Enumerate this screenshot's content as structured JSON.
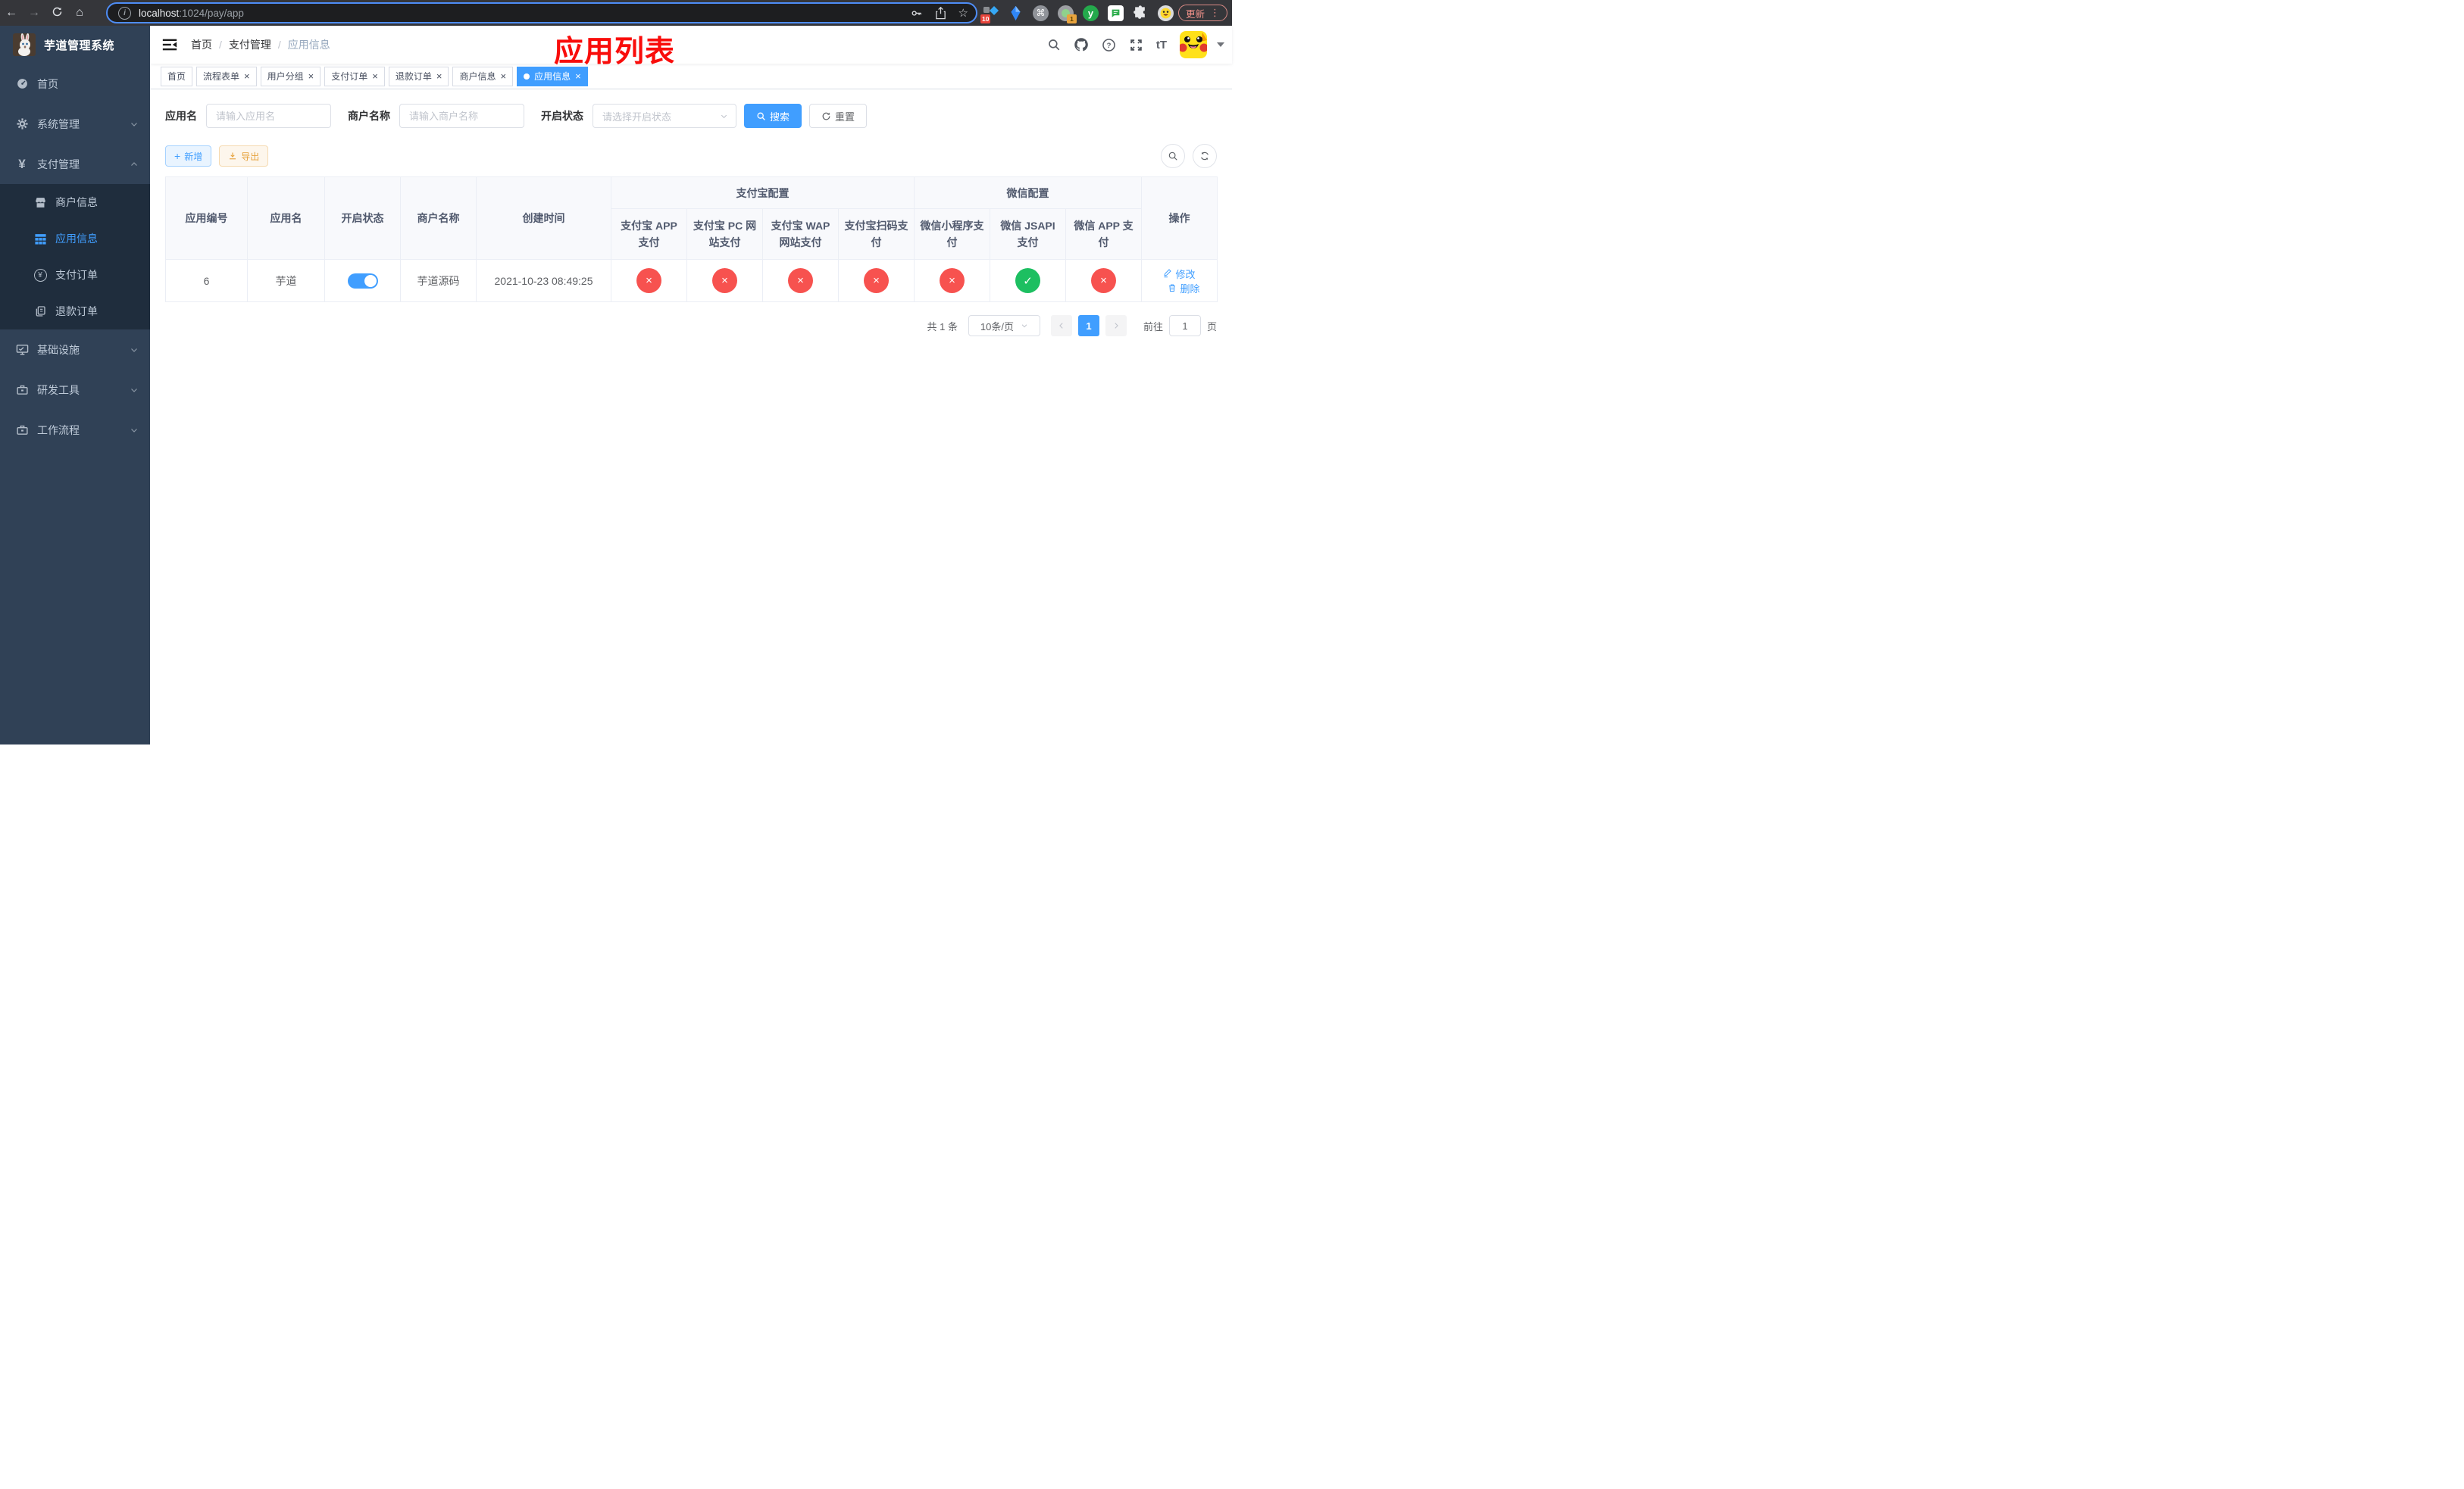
{
  "glyphs": {
    "close": "×",
    "plus": "+",
    "back": "←",
    "forward": "→",
    "home": "⌂",
    "star": "☆",
    "cmd": "⌘",
    "dots": "⋮",
    "question": "?",
    "info": "i",
    "font_size": "tT",
    "yen": "¥"
  },
  "browser": {
    "url_host": "localhost",
    "url_rest": ":1024/pay/app",
    "update_label": "更新",
    "ext_badge_10": "10",
    "ext_badge_1": "1",
    "ext_y_label": "y"
  },
  "sidebar": {
    "title": "芋道管理系统",
    "menu_top": [
      {
        "label": "首页"
      },
      {
        "label": "系统管理"
      },
      {
        "label": "支付管理"
      }
    ],
    "submenu": [
      {
        "label": "商户信息"
      },
      {
        "label": "应用信息"
      },
      {
        "label": "支付订单"
      },
      {
        "label": "退款订单"
      }
    ],
    "menu_bottom": [
      {
        "label": "基础设施"
      },
      {
        "label": "研发工具"
      },
      {
        "label": "工作流程"
      }
    ]
  },
  "navbar": {
    "breadcrumb": [
      "首页",
      "支付管理",
      "应用信息"
    ],
    "annotation": "应用列表"
  },
  "tabs": [
    {
      "label": "首页"
    },
    {
      "label": "流程表单"
    },
    {
      "label": "用户分组"
    },
    {
      "label": "支付订单"
    },
    {
      "label": "退款订单"
    },
    {
      "label": "商户信息"
    },
    {
      "label": "应用信息"
    }
  ],
  "filters": {
    "app_name_label": "应用名",
    "app_name_placeholder": "请输入应用名",
    "merchant_label": "商户名称",
    "merchant_placeholder": "请输入商户名称",
    "status_label": "开启状态",
    "status_placeholder": "请选择开启状态",
    "search_label": "搜索",
    "reset_label": "重置"
  },
  "toolbar": {
    "add_label": "新增",
    "export_label": "导出"
  },
  "table": {
    "headers": {
      "app_id": "应用编号",
      "app_name": "应用名",
      "status": "开启状态",
      "merchant": "商户名称",
      "created": "创建时间",
      "alipay_group": "支付宝配置",
      "wechat_group": "微信配置",
      "op": "操作",
      "sub": [
        "支付宝 APP 支付",
        "支付宝 PC 网站支付",
        "支付宝 WAP 网站支付",
        "支付宝扫码支付",
        "微信小程序支付",
        "微信 JSAPI 支付",
        "微信 APP 支付"
      ]
    },
    "row": {
      "app_id": "6",
      "app_name": "芋道",
      "switch_state": "on",
      "merchant": "芋道源码",
      "created": "2021-10-23 08:49:25",
      "configs": [
        {
          "symbol": "×",
          "state": "off"
        },
        {
          "symbol": "×",
          "state": "off"
        },
        {
          "symbol": "×",
          "state": "off"
        },
        {
          "symbol": "×",
          "state": "off"
        },
        {
          "symbol": "×",
          "state": "off"
        },
        {
          "symbol": "✓",
          "state": "on"
        },
        {
          "symbol": "×",
          "state": "off"
        }
      ],
      "edit_label": "修改",
      "delete_label": "删除"
    }
  },
  "pagination": {
    "total": "共 1 条",
    "per_page": "10条/页",
    "page": "1",
    "goto_label": "前往",
    "goto_value": "1",
    "page_unit": "页"
  },
  "colors": {
    "accent": "#409eff",
    "success": "#1dbf61",
    "danger": "#f7524f",
    "warning": "#e6a23c",
    "sidebar_bg": "#304156",
    "submenu_bg": "#1f2d3d",
    "focus_ring": "#4e8df6"
  }
}
